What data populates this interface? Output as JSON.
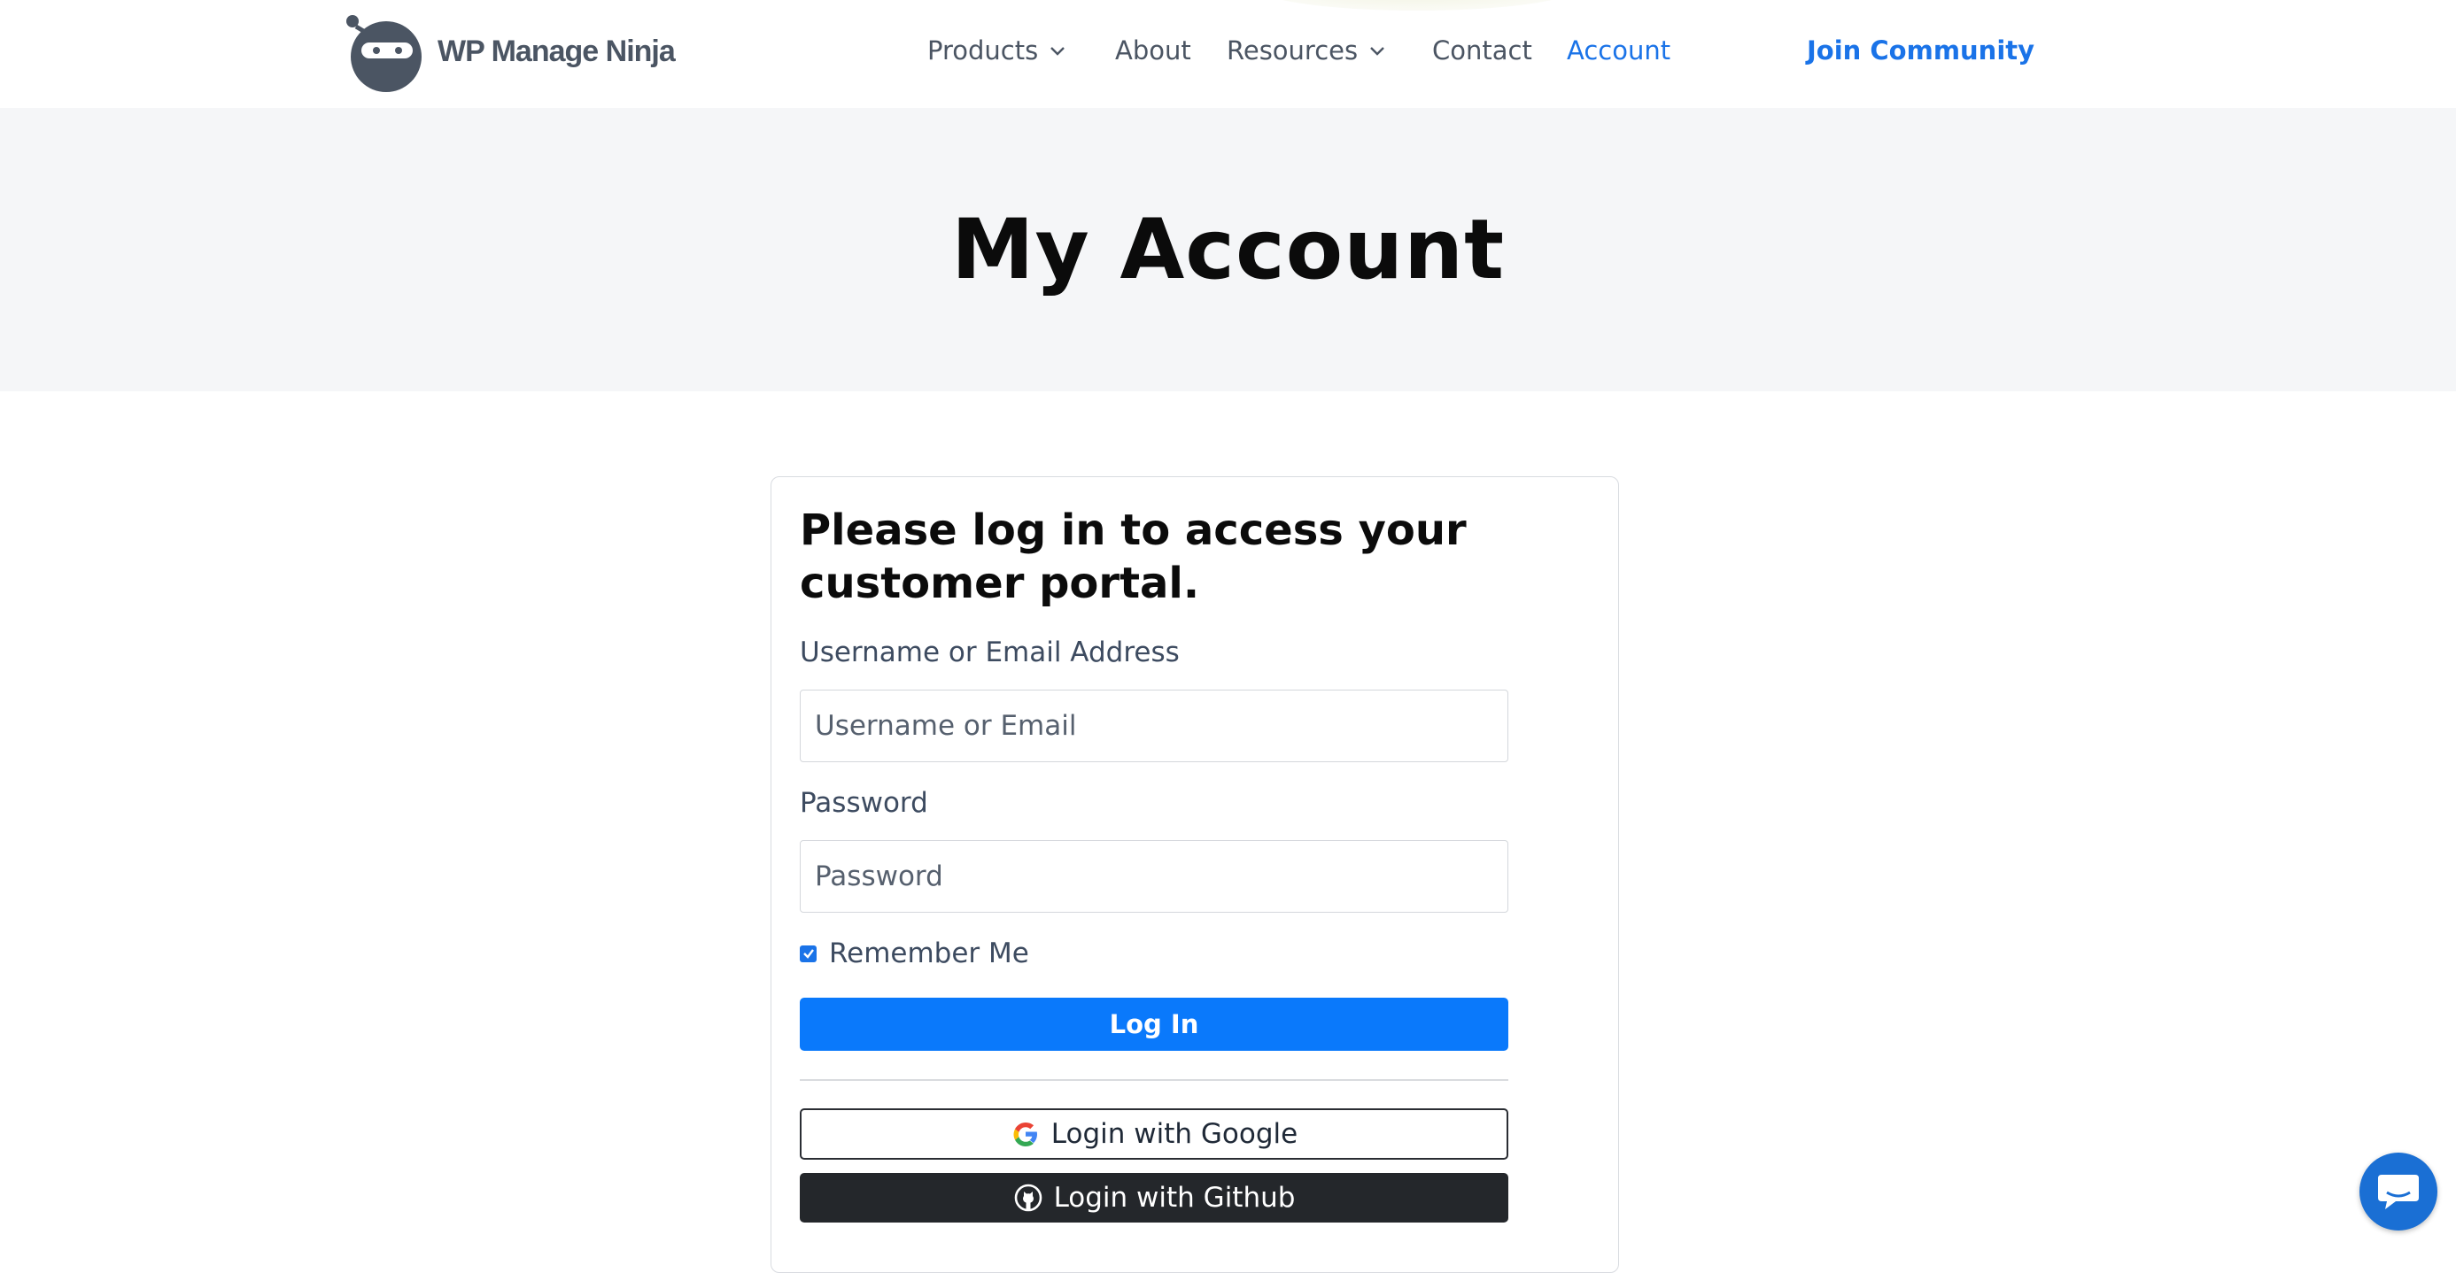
{
  "header": {
    "brand": "WP Manage Ninja",
    "nav": [
      {
        "label": "Products",
        "dropdown": true
      },
      {
        "label": "About",
        "dropdown": false
      },
      {
        "label": "Resources",
        "dropdown": true
      },
      {
        "label": "Contact",
        "dropdown": false
      },
      {
        "label": "Account",
        "dropdown": false,
        "active": true
      }
    ],
    "cta": "Join Community"
  },
  "hero": {
    "title": "My Account"
  },
  "login": {
    "heading": "Please log in to access your customer portal.",
    "username_label": "Username or Email Address",
    "username_placeholder": "Username or Email",
    "password_label": "Password",
    "password_placeholder": "Password",
    "remember_label": "Remember Me",
    "remember_checked": true,
    "submit_label": "Log In",
    "google_label": "Login with Google",
    "github_label": "Login with Github"
  },
  "colors": {
    "accent": "#1a73e8",
    "button": "#0a79fb",
    "github": "#24272b",
    "hero_bg": "#f5f6f8"
  },
  "icons": [
    "ninja-logo-icon",
    "chevron-down-icon",
    "google-icon",
    "github-icon",
    "chat-icon"
  ]
}
